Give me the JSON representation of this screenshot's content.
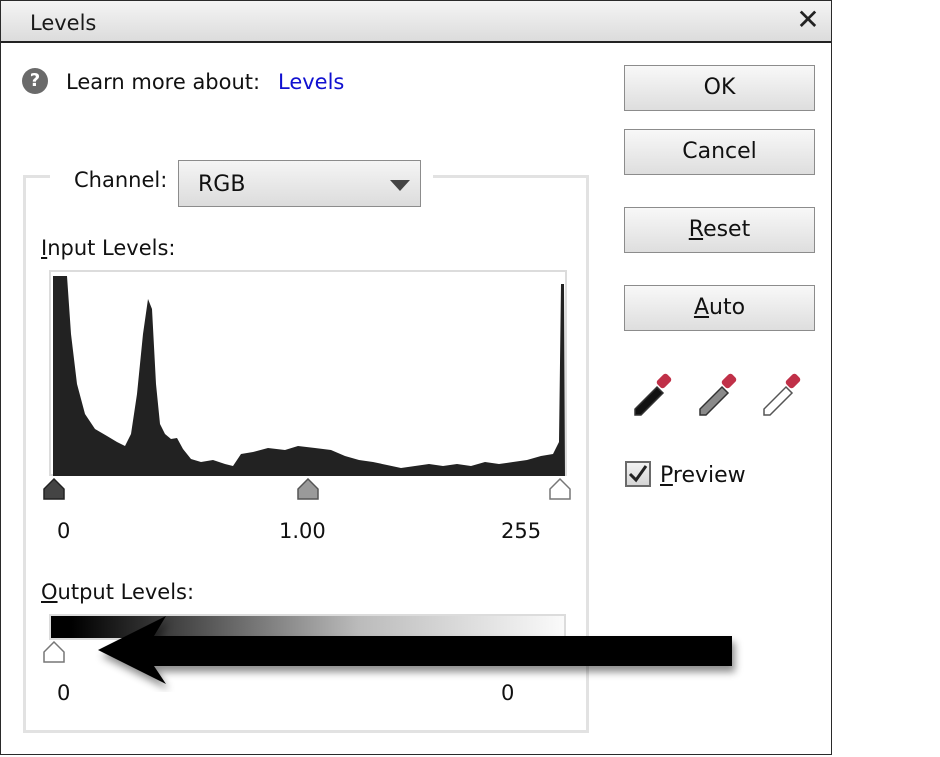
{
  "window": {
    "title": "Levels",
    "close_glyph": "✕"
  },
  "help": {
    "icon": "question-icon",
    "glyph": "?",
    "label": "Learn more about:",
    "link": "Levels"
  },
  "buttons": {
    "ok": "OK",
    "cancel": "Cancel",
    "reset_u": "R",
    "reset_rest": "eset",
    "auto_u": "A",
    "auto_rest": "uto"
  },
  "channel": {
    "label": "Channel:",
    "value": "RGB"
  },
  "input_levels": {
    "label_u": "I",
    "label_rest": "nput Levels:",
    "black": "0",
    "gamma": "1.00",
    "white": "255"
  },
  "output_levels": {
    "label_u": "O",
    "label_rest": "utput Levels:",
    "black": "0",
    "white": "0"
  },
  "eyedroppers": [
    "black-eyedropper-icon",
    "gray-eyedropper-icon",
    "white-eyedropper-icon"
  ],
  "preview": {
    "label_u": "P",
    "label_rest": "review",
    "checked": true
  },
  "colors": {
    "link": "#1010d0",
    "dropper_tip": "#c03048",
    "histogram": "#222222"
  }
}
